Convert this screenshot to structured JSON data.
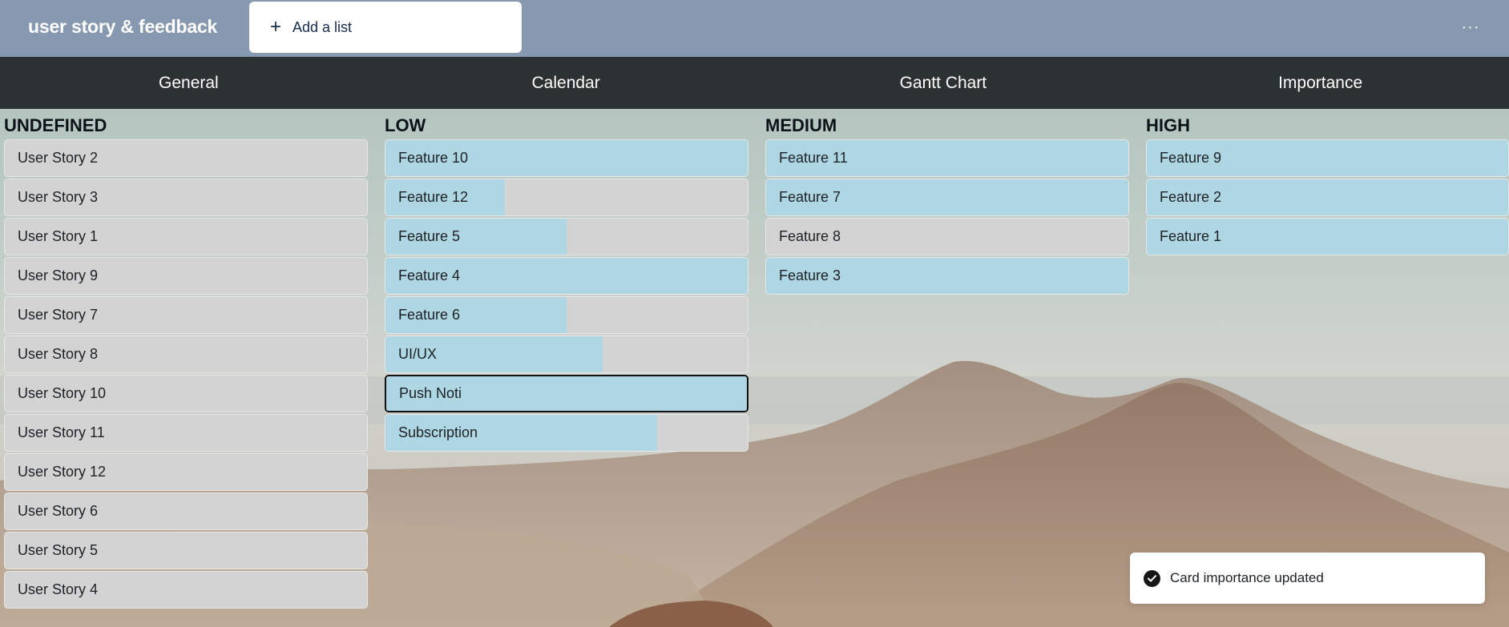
{
  "board": {
    "title": "user story & feedback"
  },
  "toolbar": {
    "add_list_label": "Add a list",
    "add_list_icon": "plus-icon",
    "menu_icon": "ellipsis-icon",
    "menu_glyph": "···"
  },
  "tabs": [
    {
      "label": "General"
    },
    {
      "label": "Calendar"
    },
    {
      "label": "Gantt Chart"
    },
    {
      "label": "Importance"
    }
  ],
  "colors": {
    "topbar": "#8799b0",
    "tabbar": "#2c3132",
    "card_base": "#d3d3d3",
    "card_progress": "#aed6e3"
  },
  "lists": [
    {
      "title": "UNDEFINED",
      "cards": [
        {
          "label": "User Story 2",
          "progress": 0
        },
        {
          "label": "User Story 3",
          "progress": 0
        },
        {
          "label": "User Story 1",
          "progress": 0
        },
        {
          "label": "User Story 9",
          "progress": 0
        },
        {
          "label": "User Story 7",
          "progress": 0
        },
        {
          "label": "User Story 8",
          "progress": 0
        },
        {
          "label": "User Story 10",
          "progress": 0
        },
        {
          "label": "User Story 11",
          "progress": 0
        },
        {
          "label": "User Story 12",
          "progress": 0
        },
        {
          "label": "User Story 6",
          "progress": 0
        },
        {
          "label": "User Story 5",
          "progress": 0
        },
        {
          "label": "User Story 4",
          "progress": 0
        }
      ]
    },
    {
      "title": "LOW",
      "cards": [
        {
          "label": "Feature 10",
          "progress": 1.0
        },
        {
          "label": "Feature 12",
          "progress": 0.33
        },
        {
          "label": "Feature 5",
          "progress": 0.5
        },
        {
          "label": "Feature 4",
          "progress": 1.0
        },
        {
          "label": "Feature 6",
          "progress": 0.5
        },
        {
          "label": "UI/UX",
          "progress": 0.6
        },
        {
          "label": "Push Noti",
          "progress": 1.0,
          "selected": true
        },
        {
          "label": "Subscription",
          "progress": 0.75
        }
      ]
    },
    {
      "title": "MEDIUM",
      "cards": [
        {
          "label": "Feature 11",
          "progress": 1.0
        },
        {
          "label": "Feature 7",
          "progress": 1.0
        },
        {
          "label": "Feature 8",
          "progress": 0
        },
        {
          "label": "Feature 3",
          "progress": 1.0
        }
      ]
    },
    {
      "title": "HIGH",
      "cards": [
        {
          "label": "Feature 9",
          "progress": 1.0
        },
        {
          "label": "Feature 2",
          "progress": 1.0
        },
        {
          "label": "Feature 1",
          "progress": 1.0
        }
      ]
    }
  ],
  "toast": {
    "message": "Card importance updated",
    "icon": "check-circle-icon"
  }
}
